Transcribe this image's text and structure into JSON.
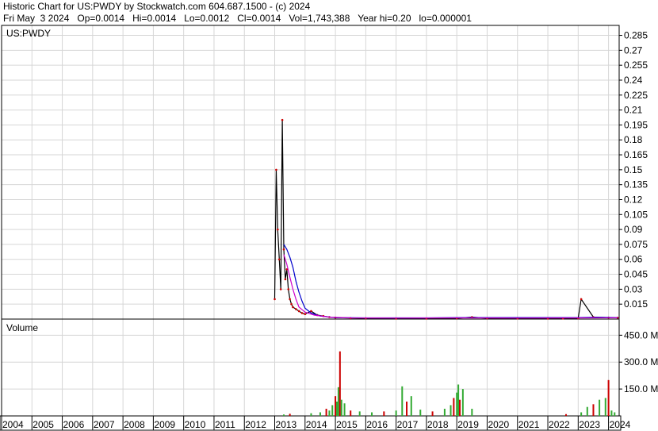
{
  "header": {
    "title": "Historic Chart for US:PWDY by Stockwatch.com 604.687.1500 - (c) 2024",
    "date": "Fri May  3 2024",
    "open": "Op=0.0014",
    "high": "Hi=0.0014",
    "low": "Lo=0.0012",
    "close": "Cl=0.0014",
    "volume": "Vol=1,743,388",
    "year_hi": "Year hi=0.20",
    "year_lo": "lo=0.000001"
  },
  "price_panel": {
    "label": "US:PWDY"
  },
  "volume_panel": {
    "label": "Volume"
  },
  "chart_data": [
    {
      "type": "line",
      "title": "US:PWDY",
      "x_range": [
        2004,
        2024.35
      ],
      "ylim": [
        0,
        0.295
      ],
      "y_ticks": [
        "0.285",
        "0.27",
        "0.255",
        "0.24",
        "0.225",
        "0.21",
        "0.195",
        "0.18",
        "0.165",
        "0.15",
        "0.135",
        "0.12",
        "0.105",
        "0.09",
        "0.075",
        "0.06",
        "0.045",
        "0.03",
        "0.015"
      ],
      "grid": true,
      "series": [
        {
          "name": "",
          "color": "#000000",
          "x": [
            2013.0,
            2013.05,
            2013.1,
            2013.15,
            2013.2,
            2013.25,
            2013.3,
            2013.35,
            2013.4,
            2013.45,
            2013.5,
            2013.55,
            2013.6,
            2013.7,
            2013.8,
            2013.9,
            2014.0,
            2014.2,
            2014.4,
            2014.6,
            2014.8,
            2015.0,
            2015.5,
            2016.0,
            2017.0,
            2018.0,
            2019.0,
            2019.5,
            2020.0,
            2021.0,
            2022.0,
            2022.5,
            2023.0,
            2023.1,
            2023.5,
            2024.0,
            2024.3
          ],
          "y": [
            0.02,
            0.15,
            0.09,
            0.06,
            0.03,
            0.2,
            0.07,
            0.04,
            0.05,
            0.03,
            0.02,
            0.015,
            0.012,
            0.01,
            0.008,
            0.006,
            0.005,
            0.008,
            0.004,
            0.003,
            0.002,
            0.0015,
            0.001,
            0.0008,
            0.0005,
            0.0005,
            0.0008,
            0.002,
            0.0008,
            0.0006,
            0.0005,
            0.0006,
            0.0008,
            0.02,
            0.002,
            0.0015,
            0.0014
          ]
        },
        {
          "name": "",
          "color": "#0000cc",
          "x": [
            2013.3,
            2013.4,
            2013.5,
            2013.6,
            2013.7,
            2013.8,
            2013.9,
            2014.0,
            2014.2,
            2014.5,
            2015.0,
            2016.0,
            2017.0,
            2018.0,
            2019.0,
            2020.0,
            2021.0,
            2022.0,
            2023.0,
            2023.5,
            2024.3
          ],
          "y": [
            0.075,
            0.07,
            0.062,
            0.052,
            0.038,
            0.027,
            0.018,
            0.011,
            0.006,
            0.003,
            0.0015,
            0.0012,
            0.0012,
            0.0012,
            0.0015,
            0.0015,
            0.0015,
            0.0015,
            0.0015,
            0.0018,
            0.0015
          ]
        },
        {
          "name": "",
          "color": "#cc00cc",
          "x": [
            2013.3,
            2013.4,
            2013.5,
            2013.6,
            2013.7,
            2013.8,
            2014.0,
            2014.3,
            2014.8,
            2015.5,
            2017.0,
            2019.0,
            2021.0,
            2023.0,
            2024.3
          ],
          "y": [
            0.065,
            0.055,
            0.042,
            0.03,
            0.02,
            0.012,
            0.007,
            0.004,
            0.002,
            0.0012,
            0.001,
            0.0012,
            0.001,
            0.0012,
            0.0013
          ]
        }
      ]
    },
    {
      "type": "bar",
      "title": "Volume",
      "ylim": [
        0,
        540
      ],
      "y_ticks": [
        "450.0 M",
        "300.0 M",
        "150.0 M"
      ],
      "x_tick_labels": [
        "2004",
        "2005",
        "2006",
        "2007",
        "2008",
        "2009",
        "2010",
        "2011",
        "2012",
        "2013",
        "2014",
        "2015",
        "2016",
        "2017",
        "2018",
        "2019",
        "2020",
        "2021",
        "2022",
        "2023",
        "2024"
      ],
      "x": [
        2013.3,
        2013.5,
        2014.2,
        2014.5,
        2014.7,
        2014.8,
        2014.9,
        2015.0,
        2015.05,
        2015.1,
        2015.15,
        2015.2,
        2015.3,
        2015.5,
        2015.8,
        2016.2,
        2016.6,
        2017.0,
        2017.2,
        2017.35,
        2017.5,
        2017.8,
        2018.2,
        2018.6,
        2018.8,
        2018.9,
        2019.0,
        2019.05,
        2019.1,
        2019.2,
        2019.5,
        2022.6,
        2023.1,
        2023.3,
        2023.5,
        2023.7,
        2023.9,
        2024.0,
        2024.1,
        2024.2
      ],
      "values": [
        8,
        12,
        15,
        20,
        40,
        30,
        60,
        110,
        80,
        160,
        360,
        90,
        70,
        30,
        25,
        20,
        25,
        30,
        165,
        80,
        110,
        35,
        25,
        40,
        60,
        100,
        130,
        175,
        90,
        150,
        40,
        10,
        20,
        50,
        65,
        90,
        100,
        200,
        30,
        20
      ]
    }
  ]
}
